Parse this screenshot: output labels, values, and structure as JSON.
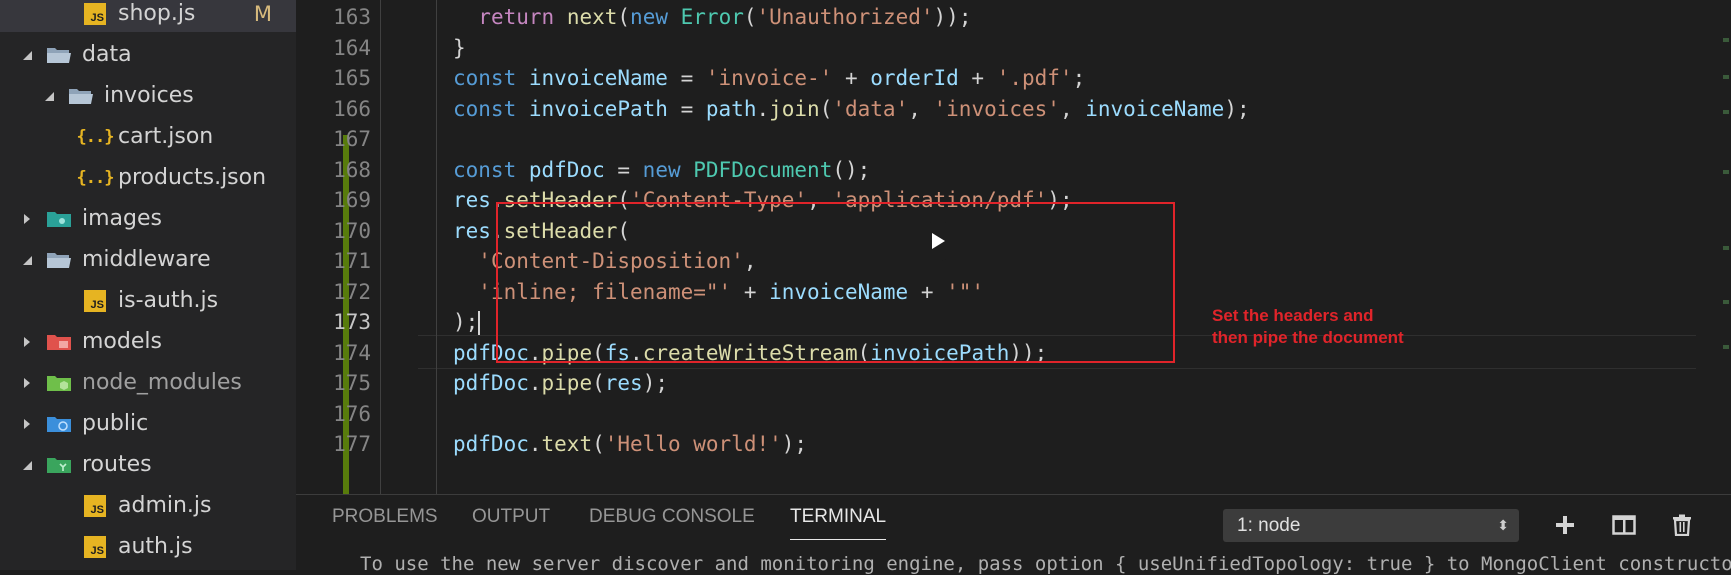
{
  "sidebar": {
    "items": [
      {
        "label": "shop.js",
        "indent": 2,
        "type": "file-js",
        "selected": true,
        "badge": "M"
      },
      {
        "label": "data",
        "indent": 0,
        "type": "folder-open",
        "expanded": true
      },
      {
        "label": "invoices",
        "indent": 1,
        "type": "folder-open",
        "expanded": true
      },
      {
        "label": "cart.json",
        "indent": 2,
        "type": "file-json"
      },
      {
        "label": "products.json",
        "indent": 2,
        "type": "file-json"
      },
      {
        "label": "images",
        "indent": 0,
        "type": "folder-images",
        "expanded": false
      },
      {
        "label": "middleware",
        "indent": 0,
        "type": "folder-open",
        "expanded": true
      },
      {
        "label": "is-auth.js",
        "indent": 2,
        "type": "file-js"
      },
      {
        "label": "models",
        "indent": 0,
        "type": "folder-models",
        "expanded": false
      },
      {
        "label": "node_modules",
        "indent": 0,
        "type": "folder-node",
        "expanded": false,
        "muted": true
      },
      {
        "label": "public",
        "indent": 0,
        "type": "folder-public",
        "expanded": false
      },
      {
        "label": "routes",
        "indent": 0,
        "type": "folder-routes",
        "expanded": true
      },
      {
        "label": "admin.js",
        "indent": 2,
        "type": "file-js"
      },
      {
        "label": "auth.js",
        "indent": 2,
        "type": "file-js"
      }
    ]
  },
  "editor": {
    "active_line": "173",
    "lines": [
      {
        "n": "163",
        "tokens": [
          [
            "",
            "  "
          ],
          [
            "kw2",
            "return"
          ],
          [
            "",
            " "
          ],
          [
            "fn",
            "next"
          ],
          [
            "",
            "("
          ],
          [
            "kw",
            "new"
          ],
          [
            "",
            " "
          ],
          [
            "cls",
            "Error"
          ],
          [
            "",
            "("
          ],
          [
            "st",
            "'Unauthorized'"
          ],
          [
            "",
            "));"
          ]
        ]
      },
      {
        "n": "164",
        "tokens": [
          [
            "",
            "}"
          ]
        ]
      },
      {
        "n": "165",
        "tokens": [
          [
            "kw",
            "const"
          ],
          [
            "",
            " "
          ],
          [
            "vr",
            "invoiceName"
          ],
          [
            "",
            " = "
          ],
          [
            "st",
            "'invoice-'"
          ],
          [
            "",
            " + "
          ],
          [
            "vr",
            "orderId"
          ],
          [
            "",
            " + "
          ],
          [
            "st",
            "'.pdf'"
          ],
          [
            "",
            ";"
          ]
        ]
      },
      {
        "n": "166",
        "tokens": [
          [
            "kw",
            "const"
          ],
          [
            "",
            " "
          ],
          [
            "vr",
            "invoicePath"
          ],
          [
            "",
            " = "
          ],
          [
            "vr",
            "path"
          ],
          [
            "",
            "."
          ],
          [
            "fn",
            "join"
          ],
          [
            "",
            "("
          ],
          [
            "st",
            "'data'"
          ],
          [
            "",
            ", "
          ],
          [
            "st",
            "'invoices'"
          ],
          [
            "",
            ", "
          ],
          [
            "vr",
            "invoiceName"
          ],
          [
            "",
            ");"
          ]
        ]
      },
      {
        "n": "167",
        "tokens": []
      },
      {
        "n": "168",
        "tokens": [
          [
            "kw",
            "const"
          ],
          [
            "",
            " "
          ],
          [
            "vr",
            "pdfDoc"
          ],
          [
            "",
            " = "
          ],
          [
            "kw",
            "new"
          ],
          [
            "",
            " "
          ],
          [
            "cls",
            "PDFDocument"
          ],
          [
            "",
            "();"
          ]
        ]
      },
      {
        "n": "169",
        "tokens": [
          [
            "vr",
            "res"
          ],
          [
            "",
            "."
          ],
          [
            "fn",
            "setHeader"
          ],
          [
            "",
            "("
          ],
          [
            "st",
            "'Content-Type'"
          ],
          [
            "",
            ", "
          ],
          [
            "st",
            "'application/pdf'"
          ],
          [
            "",
            ");"
          ]
        ]
      },
      {
        "n": "170",
        "tokens": [
          [
            "vr",
            "res"
          ],
          [
            "",
            "."
          ],
          [
            "fn",
            "setHeader"
          ],
          [
            "",
            "("
          ]
        ]
      },
      {
        "n": "171",
        "tokens": [
          [
            "",
            "  "
          ],
          [
            "st",
            "'Content-Disposition'"
          ],
          [
            "",
            ","
          ]
        ]
      },
      {
        "n": "172",
        "tokens": [
          [
            "",
            "  "
          ],
          [
            "st",
            "'inline; filename=\"'"
          ],
          [
            "",
            " + "
          ],
          [
            "vr",
            "invoiceName"
          ],
          [
            "",
            " + "
          ],
          [
            "st",
            "'\"'"
          ]
        ]
      },
      {
        "n": "173",
        "tokens": [
          [
            "",
            ");"
          ]
        ]
      },
      {
        "n": "174",
        "tokens": [
          [
            "vr",
            "pdfDoc"
          ],
          [
            "",
            "."
          ],
          [
            "fn",
            "pipe"
          ],
          [
            "",
            "("
          ],
          [
            "vr",
            "fs"
          ],
          [
            "",
            "."
          ],
          [
            "fn",
            "createWriteStream"
          ],
          [
            "",
            "("
          ],
          [
            "vr",
            "invoicePath"
          ],
          [
            "",
            "));"
          ]
        ]
      },
      {
        "n": "175",
        "tokens": [
          [
            "vr",
            "pdfDoc"
          ],
          [
            "",
            "."
          ],
          [
            "fn",
            "pipe"
          ],
          [
            "",
            "("
          ],
          [
            "vr",
            "res"
          ],
          [
            "",
            ");"
          ]
        ]
      },
      {
        "n": "176",
        "tokens": []
      },
      {
        "n": "177",
        "tokens": [
          [
            "vr",
            "pdfDoc"
          ],
          [
            "",
            "."
          ],
          [
            "fn",
            "text"
          ],
          [
            "",
            "("
          ],
          [
            "st",
            "'Hello world!'"
          ],
          [
            "",
            ");"
          ]
        ]
      }
    ]
  },
  "annotation": {
    "text_line1": "Set the headers and",
    "text_line2": "then pipe the document",
    "color": "#e0242a"
  },
  "panel": {
    "tabs": [
      "PROBLEMS",
      "OUTPUT",
      "DEBUG CONSOLE",
      "TERMINAL"
    ],
    "active_tab": "TERMINAL",
    "terminal_select": "1: node",
    "terminal_partial": "To use the new server discover and monitoring engine, pass option { useUnifiedTopology: true } to MongoClient constructor."
  },
  "colors": {
    "accent_selected": "#37373d",
    "modified_badge": "#d7ba7d",
    "git_added_gutter": "#587c0c"
  }
}
